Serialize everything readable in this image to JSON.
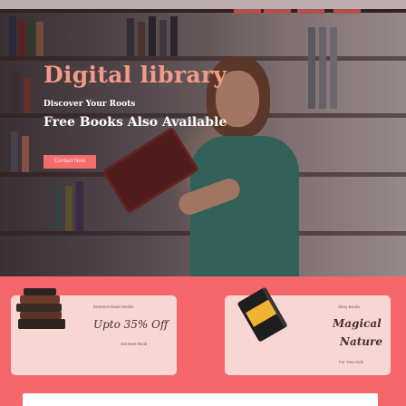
{
  "hero": {
    "title": "Digital library",
    "subtitle": "Discover Your Roots",
    "tagline": "Free Books Also Available",
    "button_label": "Contact Now"
  },
  "cards": [
    {
      "small_label": "Entrance Exam Books",
      "headline": "Upto 35% Off",
      "footer_label": "Get Best Book",
      "icon": "book-stack-icon"
    },
    {
      "small_label": "Story Books",
      "headline_line1": "Magical",
      "headline_line2": "Nature",
      "footer_label": "For Your Kids",
      "icon": "notebook-icon"
    }
  ],
  "colors": {
    "accent": "#f46d6d",
    "title": "#f29a87",
    "card_bg": "#f7d6d4"
  }
}
